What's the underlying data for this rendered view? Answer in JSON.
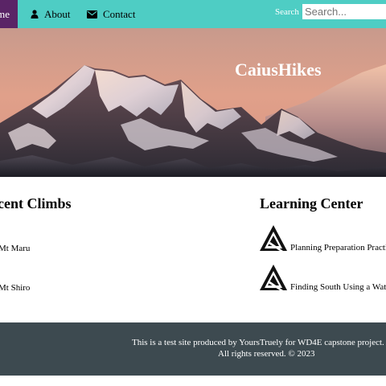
{
  "nav": {
    "home_label": "Home",
    "about_label": "About",
    "contact_label": "Contact",
    "search_label": "Search",
    "search_placeholder": "Search...",
    "about_icon": "user-icon",
    "contact_icon": "envelope-icon",
    "bar_color": "#4ecdc4",
    "active_color": "#5a2466"
  },
  "hero": {
    "title": "CaiusHikes"
  },
  "climbs": {
    "heading": "Recent Climbs",
    "items": [
      "Mt Maru",
      "Mt Shiro"
    ]
  },
  "learning": {
    "heading": "Learning Center",
    "items": [
      {
        "text": "Planning Preparation Practice",
        "icon": "triangle-logo-icon"
      },
      {
        "text": "Finding South Using a Watch",
        "icon": "triangle-logo-icon"
      }
    ]
  },
  "footer": {
    "line1": "This is a test site produced by YoursTruely for WD4E capstone project.",
    "line2": "All rights reserved. © 2023",
    "background": "#3d4a50"
  }
}
